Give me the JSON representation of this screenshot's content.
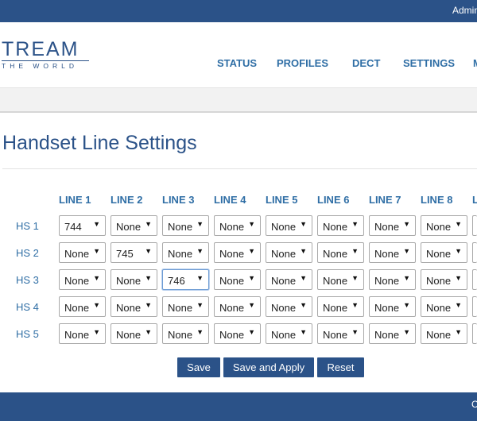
{
  "topbar": {
    "user_text": "Admin"
  },
  "brand": {
    "logo_main": "TREAM",
    "logo_sub": "THE WORLD"
  },
  "nav": [
    "STATUS",
    "PROFILES",
    "DECT",
    "SETTINGS",
    "M"
  ],
  "page": {
    "title": "Handset Line Settings"
  },
  "table": {
    "columns": [
      "LINE 1",
      "LINE 2",
      "LINE 3",
      "LINE 4",
      "LINE 5",
      "LINE 6",
      "LINE 7",
      "LINE 8",
      "L"
    ],
    "rows": [
      {
        "label": "HS 1",
        "values": [
          "744",
          "None",
          "None",
          "None",
          "None",
          "None",
          "None",
          "None",
          ""
        ]
      },
      {
        "label": "HS 2",
        "values": [
          "None",
          "745",
          "None",
          "None",
          "None",
          "None",
          "None",
          "None",
          ""
        ]
      },
      {
        "label": "HS 3",
        "values": [
          "None",
          "None",
          "746",
          "None",
          "None",
          "None",
          "None",
          "None",
          ""
        ]
      },
      {
        "label": "HS 4",
        "values": [
          "None",
          "None",
          "None",
          "None",
          "None",
          "None",
          "None",
          "None",
          ""
        ]
      },
      {
        "label": "HS 5",
        "values": [
          "None",
          "None",
          "None",
          "None",
          "None",
          "None",
          "None",
          "None",
          ""
        ]
      }
    ]
  },
  "buttons": {
    "save": "Save",
    "save_apply": "Save and Apply",
    "reset": "Reset"
  },
  "footer": {
    "text": "C"
  },
  "colors": {
    "brand_blue": "#2b5288",
    "link_blue": "#2f6ea5"
  },
  "icons": {
    "dropdown": "triangle-down-icon"
  }
}
